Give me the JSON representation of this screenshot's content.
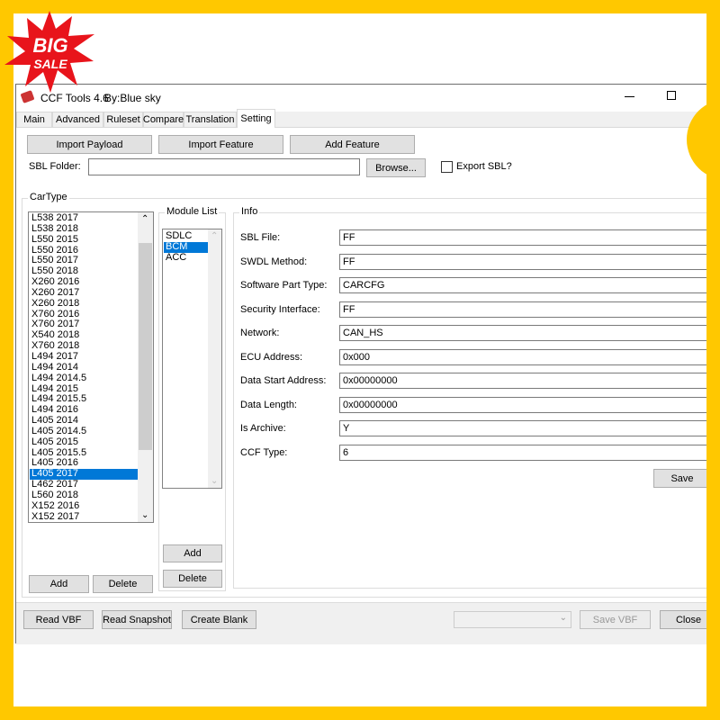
{
  "badge": {
    "line1": "BIG",
    "line2": "SALE"
  },
  "window": {
    "title": "CCF Tools 4.6",
    "author": "By:Blue sky"
  },
  "tabs": [
    "Main",
    "Advanced",
    "Ruleset",
    "Compare",
    "Translation",
    "Setting"
  ],
  "active_tab": "Setting",
  "toolbar": {
    "import_payload": "Import Payload",
    "import_feature": "Import Feature",
    "add_feature": "Add Feature"
  },
  "sbl": {
    "label": "SBL Folder:",
    "value": "",
    "browse": "Browse...",
    "export_label": "Export SBL?",
    "export_checked": false
  },
  "cartype": {
    "title": "CarType",
    "items": [
      "L538 2017",
      "L538 2018",
      "L550 2015",
      "L550 2016",
      "L550 2017",
      "L550 2018",
      "X260 2016",
      "X260 2017",
      "X260 2018",
      "X760 2016",
      "X760 2017",
      "X540 2018",
      "X760 2018",
      "L494 2017",
      "L494 2014",
      "L494 2014.5",
      "L494 2015",
      "L494 2015.5",
      "L494 2016",
      "L405 2014",
      "L405 2014.5",
      "L405 2015",
      "L405 2015.5",
      "L405 2016",
      "L405 2017",
      "L462 2017",
      "L560 2018",
      "X152 2016",
      "X152 2017"
    ],
    "selected": "L405 2017",
    "add": "Add",
    "delete": "Delete"
  },
  "modules": {
    "title": "Module List",
    "items": [
      "SDLC",
      "BCM",
      "ACC"
    ],
    "selected": "BCM",
    "add": "Add",
    "delete": "Delete"
  },
  "info": {
    "title": "Info",
    "fields": [
      {
        "label": "SBL File:",
        "value": "FF"
      },
      {
        "label": "SWDL Method:",
        "value": "FF"
      },
      {
        "label": "Software Part Type:",
        "value": "CARCFG"
      },
      {
        "label": "Security Interface:",
        "value": "FF"
      },
      {
        "label": "Network:",
        "value": "CAN_HS"
      },
      {
        "label": "ECU Address:",
        "value": "0x000"
      },
      {
        "label": "Data Start Address:",
        "value": "0x00000000"
      },
      {
        "label": "Data Length:",
        "value": "0x00000000"
      },
      {
        "label": "Is Archive:",
        "value": "Y"
      },
      {
        "label": "CCF Type:",
        "value": "6"
      }
    ],
    "save": "Save"
  },
  "bottom": {
    "read_vbf": "Read VBF",
    "read_snapshot": "Read Snapshot",
    "create_blank": "Create Blank",
    "combo_value": "",
    "save_vbf": "Save VBF",
    "close": "Close"
  },
  "colors": {
    "frame": "#ffc800",
    "selection": "#0078d7",
    "badge": "#e8141b"
  }
}
